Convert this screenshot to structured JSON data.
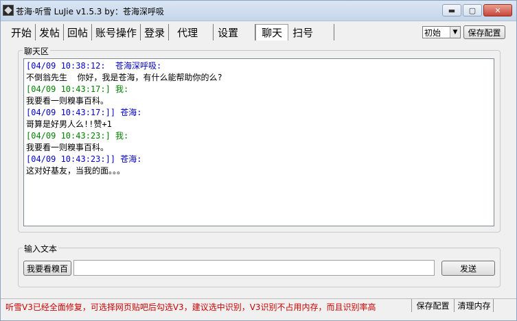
{
  "window": {
    "title": "苍海·听雪  LuJie  v1.5.3  by：苍海深呼吸",
    "minimize_label": "▬",
    "maximize_label": "▢",
    "close_label": "✕"
  },
  "tabs": [
    {
      "label": "开始"
    },
    {
      "label": "发帖"
    },
    {
      "label": "回帖"
    },
    {
      "label": "账号操作"
    },
    {
      "label": "登录"
    },
    {
      "label": "代理"
    },
    {
      "label": "设置"
    },
    {
      "label": "聊天",
      "active": true
    },
    {
      "label": "扫号"
    }
  ],
  "toolbar": {
    "preset_value": "初始",
    "save_config_label": "保存配置"
  },
  "chat": {
    "group_title": "聊天区",
    "lines": [
      {
        "text": "[04/09 10:38:12:  苍海深呼吸:",
        "style": "blue"
      },
      {
        "text": "不倒翁先生  你好，我是苍海，有什么能帮助你的么?",
        "style": "body"
      },
      {
        "text": "[04/09 10:43:17:] 我:",
        "style": "green"
      },
      {
        "text": "我要看一则糗事百科。",
        "style": "body"
      },
      {
        "text": "[04/09 10:43:17:]] 苍海:",
        "style": "blue"
      },
      {
        "text": "哥算是好男人么!!赞+1",
        "style": "body"
      },
      {
        "text": "[04/09 10:43:23:] 我:",
        "style": "green"
      },
      {
        "text": "我要看一则糗事百科。",
        "style": "body"
      },
      {
        "text": "[04/09 10:43:23:]] 苍海:",
        "style": "blue"
      },
      {
        "text": "这对好基友，当我的面。。。",
        "style": "body"
      }
    ]
  },
  "input": {
    "group_title": "输入文本",
    "quick_button_label": "我要看糗百",
    "text_value": "",
    "send_label": "发送"
  },
  "status": {
    "message": "听雪V3已经全面修复，可选择网页贴吧后勾选V3，建议选中识别，V3识别不占用内存，而且识别率高",
    "save_label": "保存配置",
    "clear_label": "清理内存"
  }
}
